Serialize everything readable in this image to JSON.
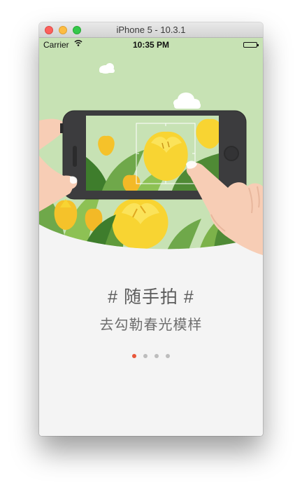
{
  "window": {
    "title": "iPhone 5 - 10.3.1"
  },
  "statusbar": {
    "carrier": "Carrier",
    "time": "10:35 PM"
  },
  "onboarding": {
    "hashtag": "# 随手拍 #",
    "tagline": "去勾勒春光模样",
    "page_count": 4,
    "current_page": 1
  },
  "colors": {
    "sky": "#c7e2b4",
    "page_indicator_active": "#e8563a",
    "page_indicator_inactive": "#bdbdbd",
    "phone_body": "#3c3c3e",
    "tulip": "#f8d432",
    "skin": "#f7cdb5"
  },
  "icons": {
    "wifi": "wifi-icon",
    "battery": "battery-icon",
    "cloud": "cloud-icon",
    "tulip": "tulip-icon",
    "focus_frame": "camera-focus-frame-icon"
  }
}
